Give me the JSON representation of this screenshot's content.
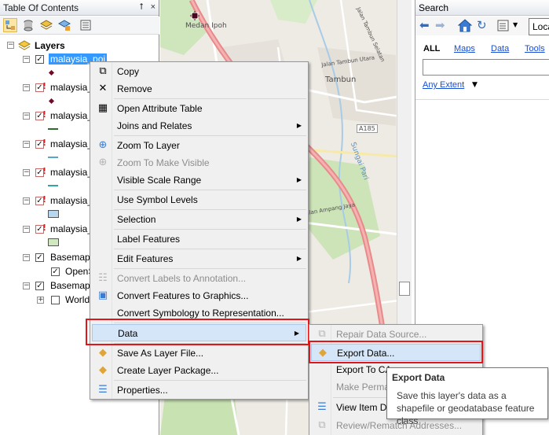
{
  "toc": {
    "title": "Table Of Contents",
    "pin_glyph": "⭡",
    "close_glyph": "×",
    "root_label": "Layers",
    "layers": [
      {
        "label": "malaysia_poi",
        "checked": "✓",
        "symbol": "point",
        "symbol_color": "#6b0d28"
      },
      {
        "label": "malaysia_",
        "checked": "✓",
        "symbol": "point",
        "symbol_color": "#6b0d28"
      },
      {
        "label": "malaysia_",
        "checked": "✓",
        "symbol": "line",
        "symbol_color": "#2b6e2b"
      },
      {
        "label": "malaysia_",
        "checked": "✓",
        "symbol": "line",
        "symbol_color": "#55a8cc"
      },
      {
        "label": "malaysia_",
        "checked": "✓",
        "symbol": "line",
        "symbol_color": "#2ea8a0"
      },
      {
        "label": "malaysia_",
        "checked": "✓",
        "symbol": "polygon",
        "symbol_color": "#b9d6ef"
      },
      {
        "label": "malaysia_",
        "checked": "✓",
        "symbol": "polygon",
        "symbol_color": "#cfe8c0"
      }
    ],
    "basemap1": {
      "label": "Basemap",
      "child": "OpenS"
    },
    "basemap2": {
      "label": "Basemap",
      "child": "World"
    }
  },
  "map": {
    "labels": [
      "Medan Ipoh",
      "Tambun",
      "A185",
      "Sungai Pari",
      "Jalan Tambun Utara",
      "Jalan Ampang Jaya",
      "Jalan Tambun Selatan"
    ]
  },
  "search": {
    "title": "Search",
    "location_value": "Loca",
    "tabs": [
      "ALL",
      "Maps",
      "Data",
      "Tools"
    ],
    "extent": "Any Extent"
  },
  "context_menu": {
    "items": [
      {
        "label": "Copy",
        "icon": "copy-icon",
        "glyph": "⧉"
      },
      {
        "label": "Remove",
        "icon": "remove-icon",
        "glyph": "✕"
      },
      {
        "label": "Open Attribute Table",
        "icon": "table-icon",
        "glyph": "▦"
      },
      {
        "label": "Joins and Relates",
        "icon": "",
        "glyph": ""
      },
      {
        "label": "Zoom To Layer",
        "icon": "zoom-layer-icon",
        "glyph": "⊕"
      },
      {
        "label": "Zoom To Make Visible",
        "icon": "zoom-visible-icon",
        "glyph": "⊕"
      },
      {
        "label": "Visible Scale Range",
        "icon": "",
        "glyph": ""
      },
      {
        "label": "Use Symbol Levels",
        "icon": "",
        "glyph": ""
      },
      {
        "label": "Selection",
        "icon": "",
        "glyph": ""
      },
      {
        "label": "Label Features",
        "icon": "",
        "glyph": ""
      },
      {
        "label": "Edit Features",
        "icon": "",
        "glyph": ""
      },
      {
        "label": "Convert Labels to Annotation...",
        "icon": "convert-labels-icon",
        "glyph": "☷"
      },
      {
        "label": "Convert Features to Graphics...",
        "icon": "convert-features-icon",
        "glyph": "▣"
      },
      {
        "label": "Convert Symbology to Representation...",
        "icon": "",
        "glyph": ""
      },
      {
        "label": "Data",
        "icon": "",
        "glyph": ""
      },
      {
        "label": "Save As Layer File...",
        "icon": "layer-file-icon",
        "glyph": "◆"
      },
      {
        "label": "Create Layer Package...",
        "icon": "layer-package-icon",
        "glyph": "◆"
      },
      {
        "label": "Properties...",
        "icon": "properties-icon",
        "glyph": "☰"
      }
    ],
    "arrow": "▶"
  },
  "data_submenu": {
    "items": [
      {
        "label": "Repair Data Source...",
        "glyph": "⧉"
      },
      {
        "label": "Export Data...",
        "glyph": "◆"
      },
      {
        "label": "Export To CA",
        "glyph": ""
      },
      {
        "label": "Make Perma",
        "glyph": ""
      },
      {
        "label": "View Item De",
        "glyph": "☰"
      },
      {
        "label": "Review/Rematch Addresses...",
        "glyph": "⧉"
      }
    ]
  },
  "tooltip": {
    "title": "Export Data",
    "body": "Save this layer's data as a shapefile or geodatabase feature class"
  },
  "colors": {
    "selection_blue": "#3399ff",
    "highlight_red": "#e0161b",
    "menu_hover": "#d6e6f9",
    "link_blue": "#1a4ed2"
  }
}
